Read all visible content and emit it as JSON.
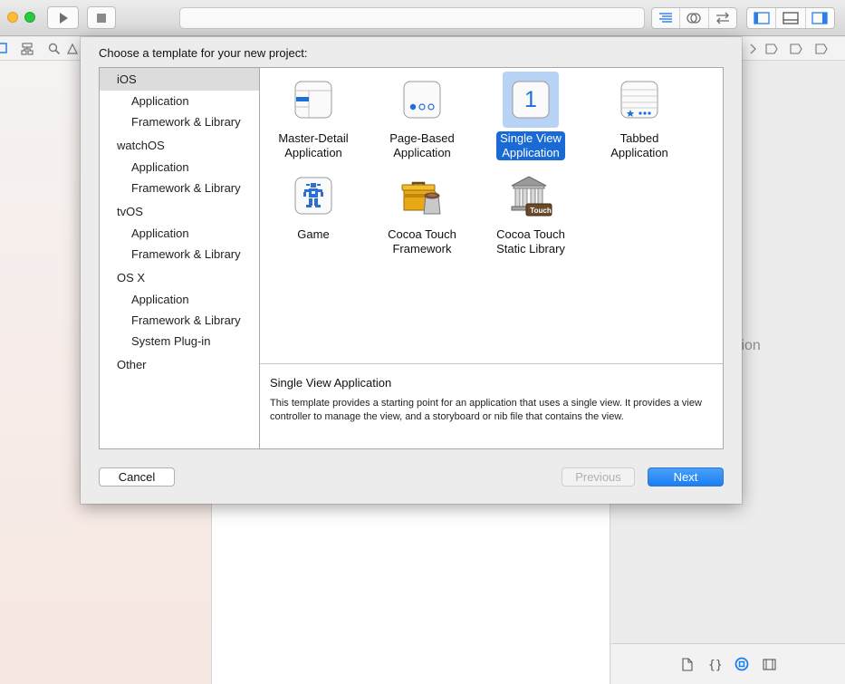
{
  "colors": {
    "selection_blue": "#1a6ad6",
    "selection_tint": "#b8d3f5",
    "next_button": "#1a7df2"
  },
  "inspector": {
    "no_selection_text": "ction"
  },
  "dialog": {
    "title": "Choose a template for your new project:",
    "platforms": [
      {
        "name": "iOS",
        "selected": true,
        "items": [
          "Application",
          "Framework & Library"
        ]
      },
      {
        "name": "watchOS",
        "items": [
          "Application",
          "Framework & Library"
        ]
      },
      {
        "name": "tvOS",
        "items": [
          "Application",
          "Framework & Library"
        ]
      },
      {
        "name": "OS X",
        "items": [
          "Application",
          "Framework & Library",
          "System Plug-in"
        ]
      },
      {
        "name": "Other",
        "items": []
      }
    ],
    "templates": [
      {
        "id": "master-detail",
        "label_1": "Master-Detail",
        "label_2": "Application",
        "icon": "master-detail-icon"
      },
      {
        "id": "page-based",
        "label_1": "Page-Based",
        "label_2": "Application",
        "icon": "page-based-icon"
      },
      {
        "id": "single-view",
        "label_1": "Single View",
        "label_2": "Application",
        "icon": "single-view-icon",
        "icon_text": "1",
        "selected": true
      },
      {
        "id": "tabbed",
        "label_1": "Tabbed",
        "label_2": "Application",
        "icon": "tabbed-icon"
      },
      {
        "id": "game",
        "label_1": "Game",
        "label_2": "",
        "icon": "game-icon"
      },
      {
        "id": "cocoa-touch-framework",
        "label_1": "Cocoa Touch",
        "label_2": "Framework",
        "icon": "toolbox-icon"
      },
      {
        "id": "cocoa-touch-static-library",
        "label_1": "Cocoa Touch",
        "label_2": "Static Library",
        "icon": "library-building-icon",
        "icon_text": "Touch"
      }
    ],
    "description": {
      "title": "Single View Application",
      "body": "This template provides a starting point for an application that uses a single view. It provides a view controller to manage the view, and a storyboard or nib file that contains the view."
    },
    "buttons": {
      "cancel": "Cancel",
      "previous": "Previous",
      "next": "Next"
    }
  }
}
